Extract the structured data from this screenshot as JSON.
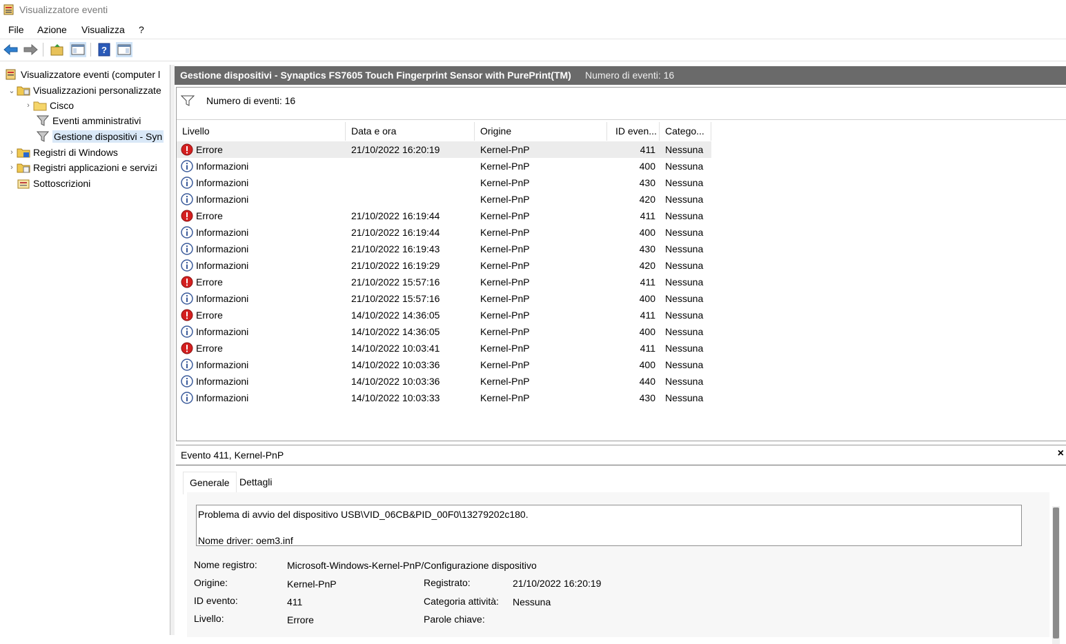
{
  "window": {
    "title": "Visualizzatore eventi"
  },
  "menu": [
    "File",
    "Azione",
    "Visualizza",
    "?"
  ],
  "toolbar": {
    "buttons": [
      "back-arrow-icon",
      "forward-arrow-icon",
      "open-folder-icon",
      "console-tree-icon",
      "help-icon",
      "action-pane-icon"
    ]
  },
  "tree": [
    {
      "label": "Visualizzatore eventi (computer l",
      "expander": "",
      "icon": "event-viewer-icon"
    },
    {
      "label": "Visualizzazioni personalizzate",
      "expander": "⌄",
      "icon": "custom-views-folder-icon"
    },
    {
      "label": "Cisco",
      "expander": "›",
      "icon": "folder-icon"
    },
    {
      "label": "Eventi amministrativi",
      "expander": "",
      "icon": "filter-icon"
    },
    {
      "label": "Gestione dispositivi - Syn",
      "expander": "",
      "icon": "filter-icon",
      "selected": true
    },
    {
      "label": "Registri di Windows",
      "expander": "›",
      "icon": "windows-logs-icon"
    },
    {
      "label": "Registri applicazioni e servizi",
      "expander": "›",
      "icon": "app-logs-icon"
    },
    {
      "label": "Sottoscrizioni",
      "expander": "",
      "icon": "subscriptions-icon"
    }
  ],
  "header": {
    "title": "Gestione dispositivi - Synaptics FS7605 Touch Fingerprint Sensor with PurePrint(TM)",
    "count": "Numero di eventi: 16"
  },
  "filter": {
    "text": "Numero di eventi: 16"
  },
  "columns": [
    "Livello",
    "Data e ora",
    "Origine",
    "ID even...",
    "Catego..."
  ],
  "events": [
    {
      "level": "Errore",
      "type": "error",
      "date": "21/10/2022 16:20:19",
      "source": "Kernel-PnP",
      "id": "411",
      "category": "Nessuna",
      "selected": true
    },
    {
      "level": "Informazioni",
      "type": "info",
      "date": "",
      "source": "Kernel-PnP",
      "id": "400",
      "category": "Nessuna"
    },
    {
      "level": "Informazioni",
      "type": "info",
      "date": "",
      "source": "Kernel-PnP",
      "id": "430",
      "category": "Nessuna"
    },
    {
      "level": "Informazioni",
      "type": "info",
      "date": "",
      "source": "Kernel-PnP",
      "id": "420",
      "category": "Nessuna"
    },
    {
      "level": "Errore",
      "type": "error",
      "date": "21/10/2022 16:19:44",
      "source": "Kernel-PnP",
      "id": "411",
      "category": "Nessuna"
    },
    {
      "level": "Informazioni",
      "type": "info",
      "date": "21/10/2022 16:19:44",
      "source": "Kernel-PnP",
      "id": "400",
      "category": "Nessuna"
    },
    {
      "level": "Informazioni",
      "type": "info",
      "date": "21/10/2022 16:19:43",
      "source": "Kernel-PnP",
      "id": "430",
      "category": "Nessuna"
    },
    {
      "level": "Informazioni",
      "type": "info",
      "date": "21/10/2022 16:19:29",
      "source": "Kernel-PnP",
      "id": "420",
      "category": "Nessuna"
    },
    {
      "level": "Errore",
      "type": "error",
      "date": "21/10/2022 15:57:16",
      "source": "Kernel-PnP",
      "id": "411",
      "category": "Nessuna"
    },
    {
      "level": "Informazioni",
      "type": "info",
      "date": "21/10/2022 15:57:16",
      "source": "Kernel-PnP",
      "id": "400",
      "category": "Nessuna"
    },
    {
      "level": "Errore",
      "type": "error",
      "date": "14/10/2022 14:36:05",
      "source": "Kernel-PnP",
      "id": "411",
      "category": "Nessuna"
    },
    {
      "level": "Informazioni",
      "type": "info",
      "date": "14/10/2022 14:36:05",
      "source": "Kernel-PnP",
      "id": "400",
      "category": "Nessuna"
    },
    {
      "level": "Errore",
      "type": "error",
      "date": "14/10/2022 10:03:41",
      "source": "Kernel-PnP",
      "id": "411",
      "category": "Nessuna"
    },
    {
      "level": "Informazioni",
      "type": "info",
      "date": "14/10/2022 10:03:36",
      "source": "Kernel-PnP",
      "id": "400",
      "category": "Nessuna"
    },
    {
      "level": "Informazioni",
      "type": "info",
      "date": "14/10/2022 10:03:36",
      "source": "Kernel-PnP",
      "id": "440",
      "category": "Nessuna"
    },
    {
      "level": "Informazioni",
      "type": "info",
      "date": "14/10/2022 10:03:33",
      "source": "Kernel-PnP",
      "id": "430",
      "category": "Nessuna"
    }
  ],
  "detail": {
    "title": "Evento 411, Kernel-PnP",
    "close": "×",
    "tabs": [
      {
        "label": "Generale",
        "active": true
      },
      {
        "label": "Dettagli",
        "active": false
      }
    ],
    "message_lines": [
      "Problema di avvio del dispositivo USB\\VID_06CB&PID_00F0\\13279202c180.",
      "",
      "Nome driver: oem3.inf"
    ],
    "props": {
      "log_name_label": "Nome registro:",
      "log_name": "Microsoft-Windows-Kernel-PnP/Configurazione dispositivo",
      "source_label": "Origine:",
      "source": "Kernel-PnP",
      "logged_label": "Registrato:",
      "logged": "21/10/2022 16:20:19",
      "event_id_label": "ID evento:",
      "event_id": "411",
      "task_label": "Categoria attività:",
      "task": "Nessuna",
      "level_label": "Livello:",
      "level": "Errore",
      "keywords_label": "Parole chiave:",
      "keywords": ""
    }
  },
  "colors": {
    "header_bg": "#6a6a6a",
    "selection": "#ececec",
    "tree_selection": "#d9e8f7",
    "error": "#d42020",
    "info_ring": "#3a5a9a"
  }
}
